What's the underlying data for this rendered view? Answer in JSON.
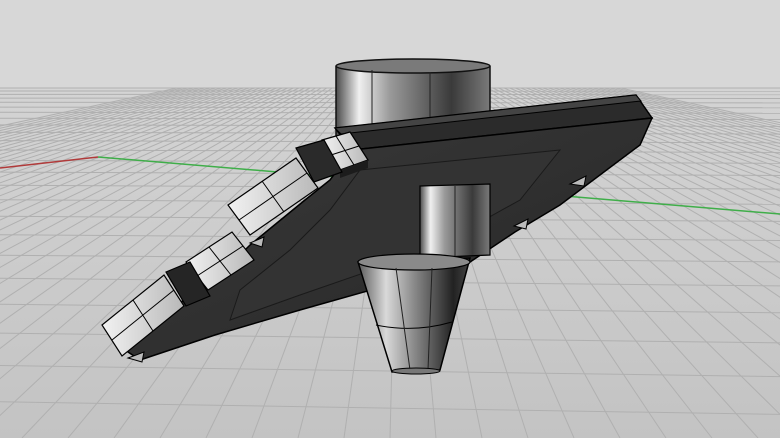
{
  "viewport": {
    "projection": "perspective",
    "display_mode": "shaded",
    "colors": {
      "background_top": "#d6d6d6",
      "background_bottom": "#c2c2c2",
      "grid_line": "#b0b0b0",
      "x_axis": "#b03a3a",
      "y_axis": "#3fae49",
      "model_dark": "#2a2a2a",
      "model_mid": "#6e6e6e",
      "model_light": "#e8e8e8"
    }
  },
  "model": {
    "parts": [
      "top-cylinder",
      "sloped-plate",
      "lower-cone"
    ]
  }
}
